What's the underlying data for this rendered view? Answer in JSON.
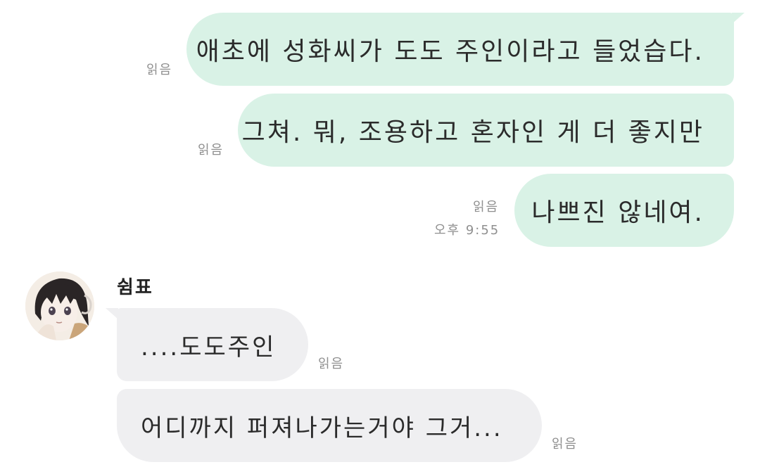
{
  "chat": {
    "outgoing": [
      {
        "text": "애초에 성화씨가 도도 주인이라고 들었습다.",
        "read": "읽음"
      },
      {
        "text": "그쳐. 뭐, 조용하고 혼자인 게 더 좋지만",
        "read": "읽음"
      },
      {
        "text": "나쁘진 않네여.",
        "read": "읽음",
        "time": "오후 9:55"
      }
    ],
    "contact": {
      "name": "쉼표",
      "avatar_icon": "profile-avatar-icon"
    },
    "incoming": [
      {
        "text": "....도도주인",
        "read": "읽음"
      },
      {
        "text": "어디까지 퍼져나가는거야 그거...",
        "read": "읽음"
      }
    ],
    "colors": {
      "outgoing_bubble": "#d9f2e6",
      "incoming_bubble": "#efeff1",
      "meta_text": "#8f8f8f"
    }
  }
}
